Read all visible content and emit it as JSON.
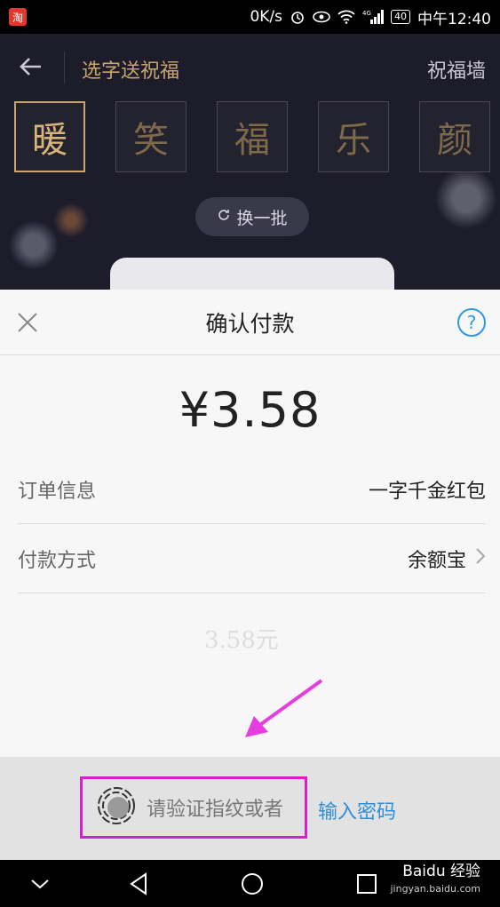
{
  "status_bar": {
    "app_badge": "淘",
    "speed": "0K/s",
    "network": "4G",
    "battery": "40",
    "time": "中午12:40"
  },
  "background_app": {
    "title": "选字送祝福",
    "wall_link": "祝福墙",
    "characters": [
      "暖",
      "笑",
      "福",
      "乐",
      "颜"
    ],
    "selected_index": 0,
    "swap_label": "换一批",
    "ghost_amount": "3.58元"
  },
  "payment": {
    "title": "确认付款",
    "help_label": "?",
    "amount": "¥3.58",
    "order_label": "订单信息",
    "order_value": "一字千金红包",
    "method_label": "付款方式",
    "method_value": "余额宝"
  },
  "verify": {
    "prompt": "请验证指纹或者",
    "password_link": "输入密码"
  },
  "watermark": {
    "brand": "Baidu 经验",
    "site": "jingyan.baidu.com"
  },
  "colors": {
    "accent_blue": "#2f9ae0",
    "annotation_magenta": "#d91ed0",
    "gold": "#c9a56b"
  }
}
